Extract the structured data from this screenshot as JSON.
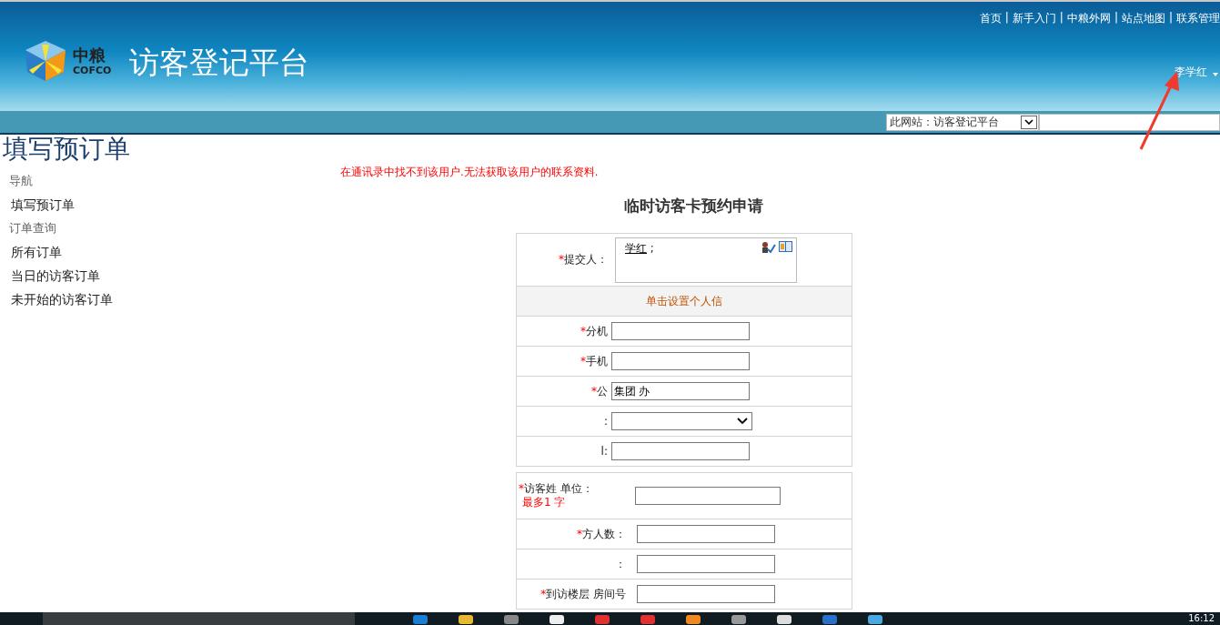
{
  "header": {
    "logo_cn": "中粮",
    "logo_en": "COFCO",
    "site_title": "访客登记平台",
    "top_links": [
      "首页",
      "新手入门",
      "中粮外网",
      "站点地图",
      "联系管理"
    ],
    "link_separator": "|",
    "user": "李学红",
    "search_scope": "此网站：访客登记平台"
  },
  "page_title": "填写预订单",
  "nav": [
    {
      "kind": "heading",
      "label": "导航"
    },
    {
      "kind": "link",
      "label": "填写预订单"
    },
    {
      "kind": "heading",
      "label": "订单查询"
    },
    {
      "kind": "link",
      "label": "所有订单"
    },
    {
      "kind": "link",
      "label": "当日的访客订单"
    },
    {
      "kind": "link",
      "label": "未开始的访客订单"
    }
  ],
  "error_message": "在通讯录中找不到该用户.无法获取该用户的联系资料.",
  "form": {
    "title": "临时访客卡预约申请",
    "submitter": {
      "mark": "*",
      "label": "提交人：",
      "name": "学红",
      "separator": ";"
    },
    "personal_link": "单击设置个人信",
    "section_1": [
      {
        "kind": "input",
        "mark": "*",
        "label": "分机"
      },
      {
        "kind": "input",
        "mark": "*",
        "label": "手机"
      },
      {
        "kind": "input",
        "mark": "*",
        "label": "公",
        "value": "集团 办"
      },
      {
        "kind": "select",
        "label": ":"
      },
      {
        "kind": "input",
        "label": "l:"
      }
    ],
    "section_2": [
      {
        "kind": "input",
        "mark": "*",
        "label": "访客姓 单位：",
        "note": "最多1 字"
      },
      {
        "kind": "input",
        "mark": "*",
        "label": "方人数："
      },
      {
        "kind": "input",
        "label": "："
      },
      {
        "kind": "input",
        "mark": "*",
        "label": "到访楼层 房间号"
      }
    ]
  },
  "taskbar": {
    "clock": "16:12"
  }
}
